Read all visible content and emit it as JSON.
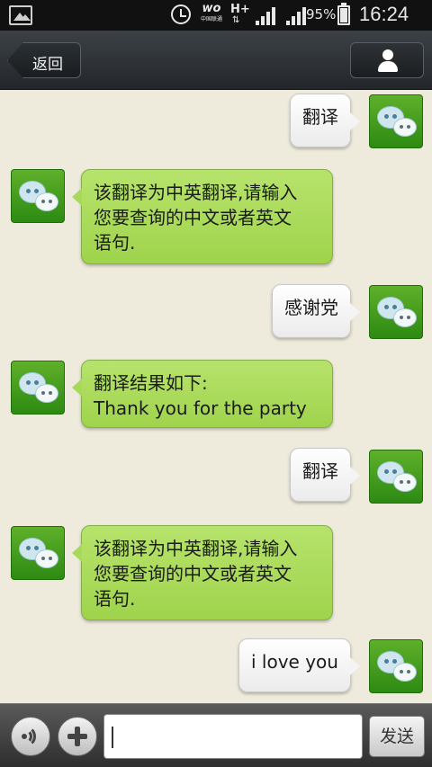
{
  "status_bar": {
    "carrier_logo_text": "wo",
    "carrier_name": "中国联通",
    "network_type": "H+",
    "network_arrows": "⇅",
    "battery_percent": "95%",
    "battery_level": 0.95,
    "time": "16:24"
  },
  "header": {
    "back_label": "返回",
    "profile_icon": "person-icon"
  },
  "messages": [
    {
      "direction": "out",
      "lines": [
        "翻译"
      ]
    },
    {
      "direction": "in",
      "lines": [
        "该翻译为中英翻译,请输入",
        "您要查询的中文或者英文",
        "语句."
      ]
    },
    {
      "direction": "out",
      "lines": [
        "感谢党"
      ]
    },
    {
      "direction": "in",
      "lines": [
        "翻译结果如下:",
        "Thank you for the party"
      ]
    },
    {
      "direction": "out",
      "lines": [
        "翻译"
      ]
    },
    {
      "direction": "in",
      "lines": [
        "该翻译为中英翻译,请输入",
        "您要查询的中文或者英文",
        "语句."
      ]
    },
    {
      "direction": "out",
      "lines": [
        "i love you"
      ]
    }
  ],
  "input_bar": {
    "voice_icon": "voice-icon",
    "plus_icon": "plus-icon",
    "input_value": "",
    "send_label": "发送"
  },
  "colors": {
    "incoming_bubble": "#a9d95a",
    "outgoing_bubble": "#ffffff",
    "chat_background": "#efebdc",
    "avatar_green": "#3f9a1c"
  }
}
